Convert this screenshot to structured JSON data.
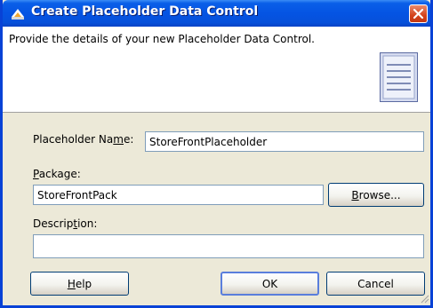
{
  "window": {
    "title": "Create Placeholder Data Control"
  },
  "header": {
    "description": "Provide the details of your new Placeholder Data Control."
  },
  "form": {
    "placeholder_name": {
      "label_before": "Placeholder Na",
      "label_mnemonic": "m",
      "label_after": "e:",
      "value": "StoreFrontPlaceholder"
    },
    "package": {
      "label_mnemonic": "P",
      "label_after": "ackage:",
      "value": "StoreFrontPack"
    },
    "browse_button": {
      "label_mnemonic": "B",
      "label_after": "rowse..."
    },
    "description": {
      "label_before": "Descrip",
      "label_mnemonic": "t",
      "label_after": "ion:",
      "value": ""
    }
  },
  "buttons": {
    "help_mnemonic": "H",
    "help_after": "elp",
    "ok": "OK",
    "cancel": "Cancel"
  },
  "icons": {
    "app": "wizard-icon",
    "close": "close-icon",
    "header": "document-list-icon",
    "resize": "resize-grip-icon"
  },
  "colors": {
    "titlebar": "#0554e3",
    "close": "#d3431c",
    "dialog_bg": "#ece9d8"
  }
}
